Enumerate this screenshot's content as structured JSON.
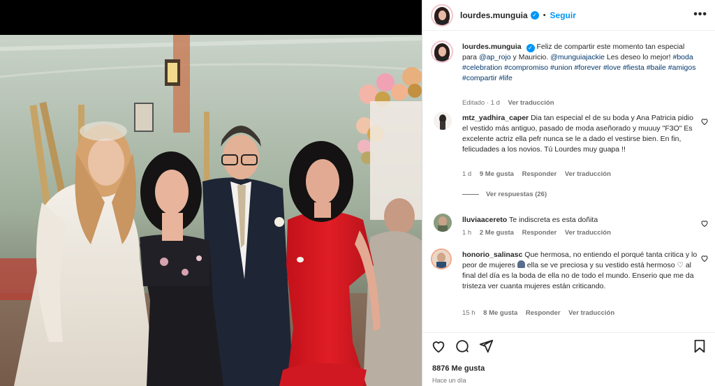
{
  "post": {
    "username": "lourdes.munguia",
    "follow_label": "Seguir",
    "more_label": "•••",
    "caption_parts": [
      "Feliz de compartir este momento tan especial para ",
      "@ap_rojo",
      " y Mauricio. ",
      "@munguiajackie",
      " Les deseo lo mejor! "
    ],
    "hashtags": "#boda #celebration #compromiso #union #forever #love #fiesta #baile #amigos #compartir #life",
    "edited": "Editado · 1 d",
    "see_translation": "Ver traducción",
    "likes": "8876 Me gusta",
    "time_ago": "Hace un día"
  },
  "comments": [
    {
      "username": "mtz_yadhira_caper",
      "text": "Dia tan especial el de su boda y Ana Patricia pidio el vestido más antiguo, pasado de moda aseñorado y muuuy \"F3O\" Es excelente actriz ella pefr nunca se le a dado el vestirse bien. En fin, felicudades a los novios. Tú Lourdes muy guapa !!",
      "time": "1 d",
      "likes": "9 Me gusta",
      "reply": "Responder",
      "translate": "Ver traducción",
      "view_replies": "Ver respuestas (26)"
    },
    {
      "username": "lluviaacereto",
      "text": "Te indiscreta es esta doñita",
      "time": "1 h",
      "likes": "2 Me gusta",
      "reply": "Responder",
      "translate": "Ver traducción"
    },
    {
      "username": "honorio_salinasc",
      "text_a": "Que hermosa, no entiendo el porqué tanta critica y lo peor de mujeres ",
      "text_b": " ella se ve preciosa y su vestido está hermoso ",
      "text_c": " al final del día es la boda de ella no de todo el mundo. Enserio que me da tristeza ver cuanta mujeres están criticando.",
      "time": "15 h",
      "likes": "8 Me gusta",
      "reply": "Responder",
      "translate": "Ver traducción"
    }
  ],
  "icons": [
    "verified-badge",
    "heart-icon",
    "comment-icon",
    "share-icon",
    "bookmark-icon",
    "more-icon"
  ],
  "colors": {
    "link": "#00376b",
    "accent": "#0095f6",
    "muted": "#737373",
    "text": "#262626"
  }
}
